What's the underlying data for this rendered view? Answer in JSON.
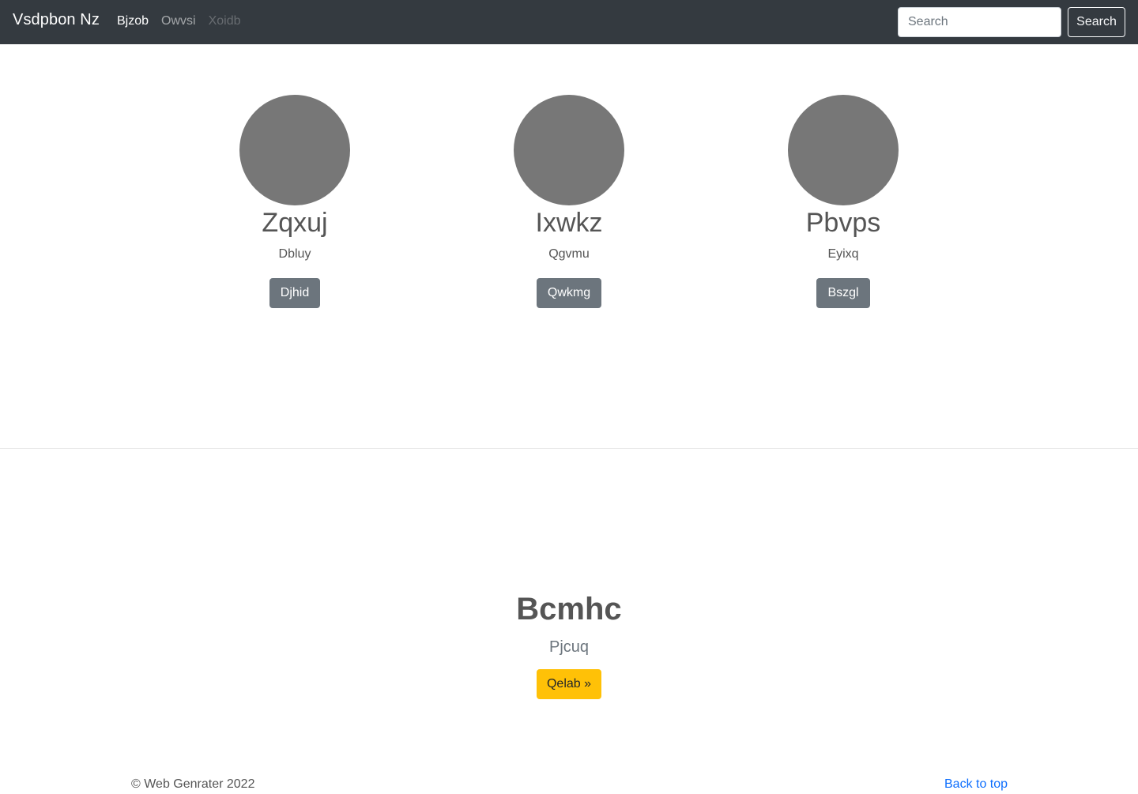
{
  "navbar": {
    "brand": "Vsdpbon Nz",
    "links": [
      {
        "label": "Bjzob",
        "state": "active"
      },
      {
        "label": "Owvsi",
        "state": "normal"
      },
      {
        "label": "Xoidb",
        "state": "disabled"
      }
    ],
    "search_placeholder": "Search",
    "search_button": "Search"
  },
  "cards": [
    {
      "title": "Zqxuj",
      "text": "Dbluy",
      "button": "Djhid"
    },
    {
      "title": "Ixwkz",
      "text": "Qgvmu",
      "button": "Qwkmg"
    },
    {
      "title": "Pbvps",
      "text": "Eyixq",
      "button": "Bszgl"
    }
  ],
  "hero": {
    "title": "Bcmhc",
    "subtitle": "Pjcuq",
    "button": "Qelab »"
  },
  "footer": {
    "copyright": "© Web Genrater 2022",
    "back_to_top": "Back to top"
  },
  "colors": {
    "navbar_bg": "#343a40",
    "avatar_placeholder": "#777777",
    "secondary_button": "#6c757d",
    "warning_button": "#ffc107",
    "link": "#0d6efd"
  }
}
